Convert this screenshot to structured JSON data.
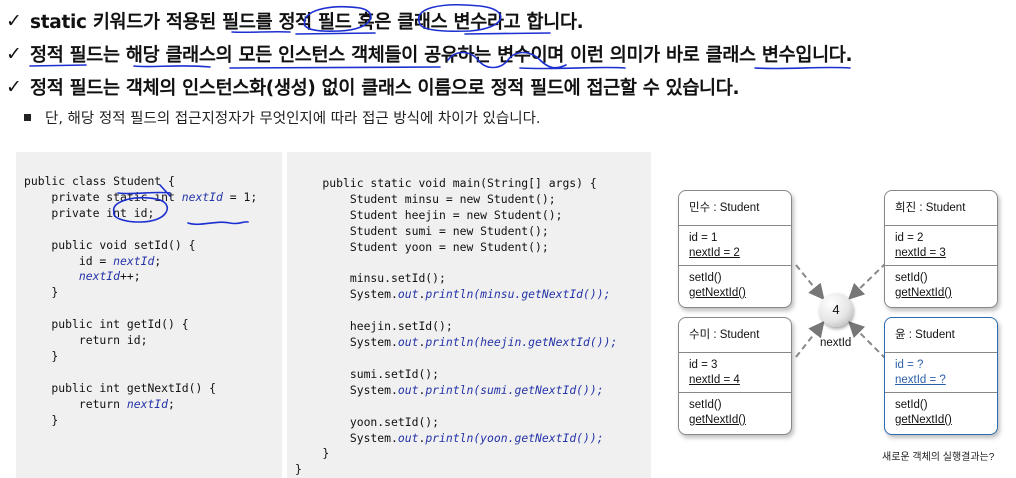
{
  "bullets": [
    "static 키워드가 적용된 필드를 정적 필드 혹은 클래스 변수라고 합니다.",
    "정적 필드는 해당 클래스의 모든 인스턴스 객체들이 공유하는 변수이며 이런 의미가 바로 클래스 변수입니다.",
    "정적 필드는 객체의 인스턴스화(생성) 없이 클래스 이름으로 정적 필드에 접근할 수 있습니다."
  ],
  "check_mark": "✓",
  "sub_bullet": "단, 해당 정적 필드의 접근지정자가 무엇인지에 따라 접근 방식에 차이가 있습니다.",
  "code_left": {
    "class_decl": "public class Student {",
    "field1": "    private static int nextId = 1;",
    "field2": "    private int id;",
    "m1_sig": "    public void setId() {",
    "m1_l1": "        id = nextId;",
    "m1_l2": "        nextId++;",
    "m1_end": "    }",
    "m2_sig": "    public int getId() {",
    "m2_l1": "        return id;",
    "m2_end": "    }",
    "m3_sig": "    public int getNextId() {",
    "m3_l1": "        return nextId;",
    "m3_end": "    }"
  },
  "code_right": {
    "main_sig": "    public static void main(String[] args) {",
    "l1": "        Student minsu = new Student();",
    "l2": "        Student heejin = new Student();",
    "l3": "        Student sumi = new Student();",
    "l4": "        Student yoon = new Student();",
    "l5": "        minsu.setId();",
    "l6": "        System.out.println(minsu.getNextId());",
    "l7": "        heejin.setId();",
    "l8": "        System.out.println(heejin.getNextId());",
    "l9": "        sumi.setId();",
    "l10": "        System.out.println(sumi.getNextId());",
    "l11": "        yoon.setId();",
    "l12": "        System.out.println(yoon.getNextId());",
    "main_end": "    }",
    "class_end": "}"
  },
  "diagram": {
    "objects": [
      {
        "title": "민수 : Student",
        "id": "id = 1",
        "next": "nextId = 2",
        "m1": "setId()",
        "m2": "getNextId()"
      },
      {
        "title": "희진 : Student",
        "id": "id = 2",
        "next": "nextId = 3",
        "m1": "setId()",
        "m2": "getNextId()"
      },
      {
        "title": "수미 : Student",
        "id": "id = 3",
        "next": "nextId = 4",
        "m1": "setId()",
        "m2": "getNextId()"
      },
      {
        "title": "윤 : Student",
        "id": "id = ?",
        "next": "nextId = ?",
        "m1": "setId()",
        "m2": "getNextId()"
      }
    ],
    "shared_value": "4",
    "shared_label": "nextId",
    "caption": "새로운 객체의 실행결과는?"
  },
  "colors": {
    "ink": "#1c2fd0",
    "code_field": "#2433a8",
    "highlight_box": "#2b6bb2",
    "panel_bg": "#f0f0f0"
  }
}
